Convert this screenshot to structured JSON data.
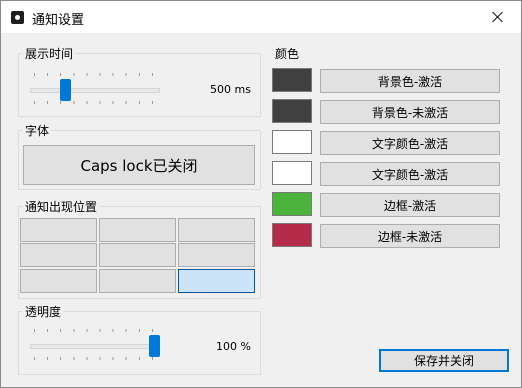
{
  "window": {
    "title": "通知设置",
    "close_label": "×"
  },
  "display_time": {
    "label": "展示时间",
    "value_text": "500 ms",
    "slider_fraction": 0.25
  },
  "font": {
    "label": "字体",
    "button_label": "Caps lock已关闭"
  },
  "position": {
    "label": "通知出现位置",
    "selected_index": 8,
    "cells": 9
  },
  "opacity": {
    "label": "透明度",
    "value_text": "100 %",
    "slider_fraction": 1.0
  },
  "colors": {
    "label": "颜色",
    "items": [
      {
        "swatch": "#404040",
        "button_label": "背景色-激活"
      },
      {
        "swatch": "#404040",
        "button_label": "背景色-未激活"
      },
      {
        "swatch": "#ffffff",
        "button_label": "文字颜色-激活"
      },
      {
        "swatch": "#ffffff",
        "button_label": "文字颜色-激活"
      },
      {
        "swatch": "#4cb43c",
        "button_label": "边框-激活"
      },
      {
        "swatch": "#b52b4a",
        "button_label": "边框-未激活"
      }
    ]
  },
  "footer": {
    "save_label": "保存并关闭"
  }
}
